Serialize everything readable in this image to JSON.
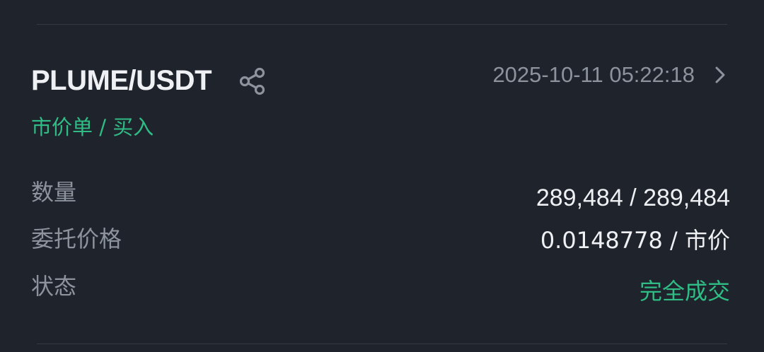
{
  "order": {
    "pair": "PLUME/USDT",
    "datetime": "2025-10-11 05:22:18",
    "order_type": "市价单 / 买入"
  },
  "details": {
    "quantity_label": "数量",
    "quantity_value": "289,484 / 289,484",
    "price_label": "委托价格",
    "price_value": "0.0148778 / 市价",
    "status_label": "状态",
    "status_value": "完全成交"
  },
  "icons": {
    "share": "share-icon",
    "chevron": "chevron-right-icon"
  },
  "colors": {
    "background": "#1f242c",
    "primary_text": "#eef0f3",
    "secondary_text": "#8c939d",
    "accent_green": "#2fbd85"
  }
}
